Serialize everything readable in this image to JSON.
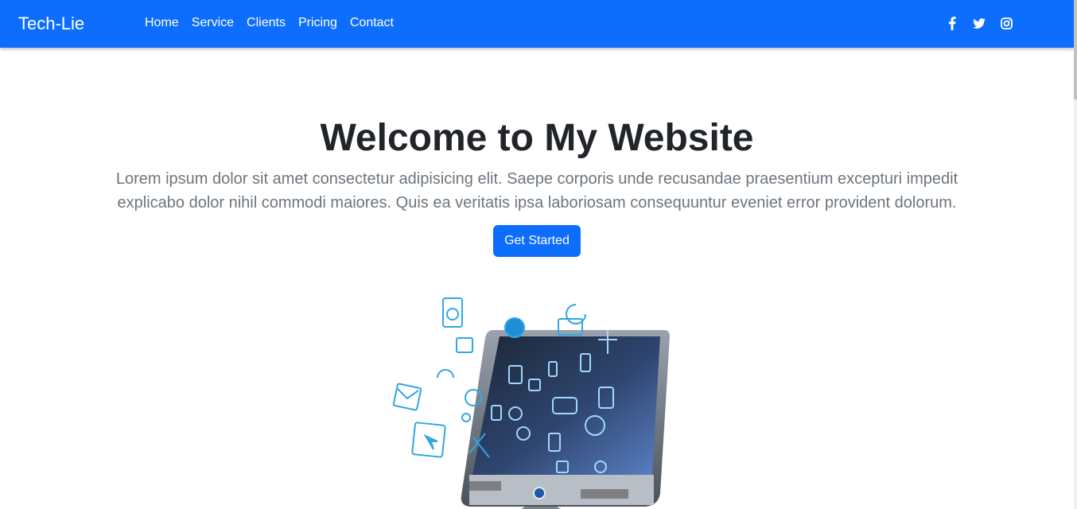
{
  "nav": {
    "brand": "Tech-Lie",
    "links": [
      "Home",
      "Service",
      "Clients",
      "Pricing",
      "Contact"
    ],
    "social_icons": [
      "facebook-icon",
      "twitter-icon",
      "instagram-icon"
    ]
  },
  "hero": {
    "title": "Welcome to My Website",
    "text": "Lorem ipsum dolor sit amet consectetur adipisicing elit. Saepe corporis unde recusandae praesentium excepturi impedit explicabo dolor nihil commodi maiores. Quis ea veritatis ipsa laboriosam consequuntur eveniet error provident dolorum.",
    "button_label": "Get Started"
  },
  "colors": {
    "primary": "#0d6efd",
    "heading": "#212529",
    "muted": "#6c757d"
  }
}
